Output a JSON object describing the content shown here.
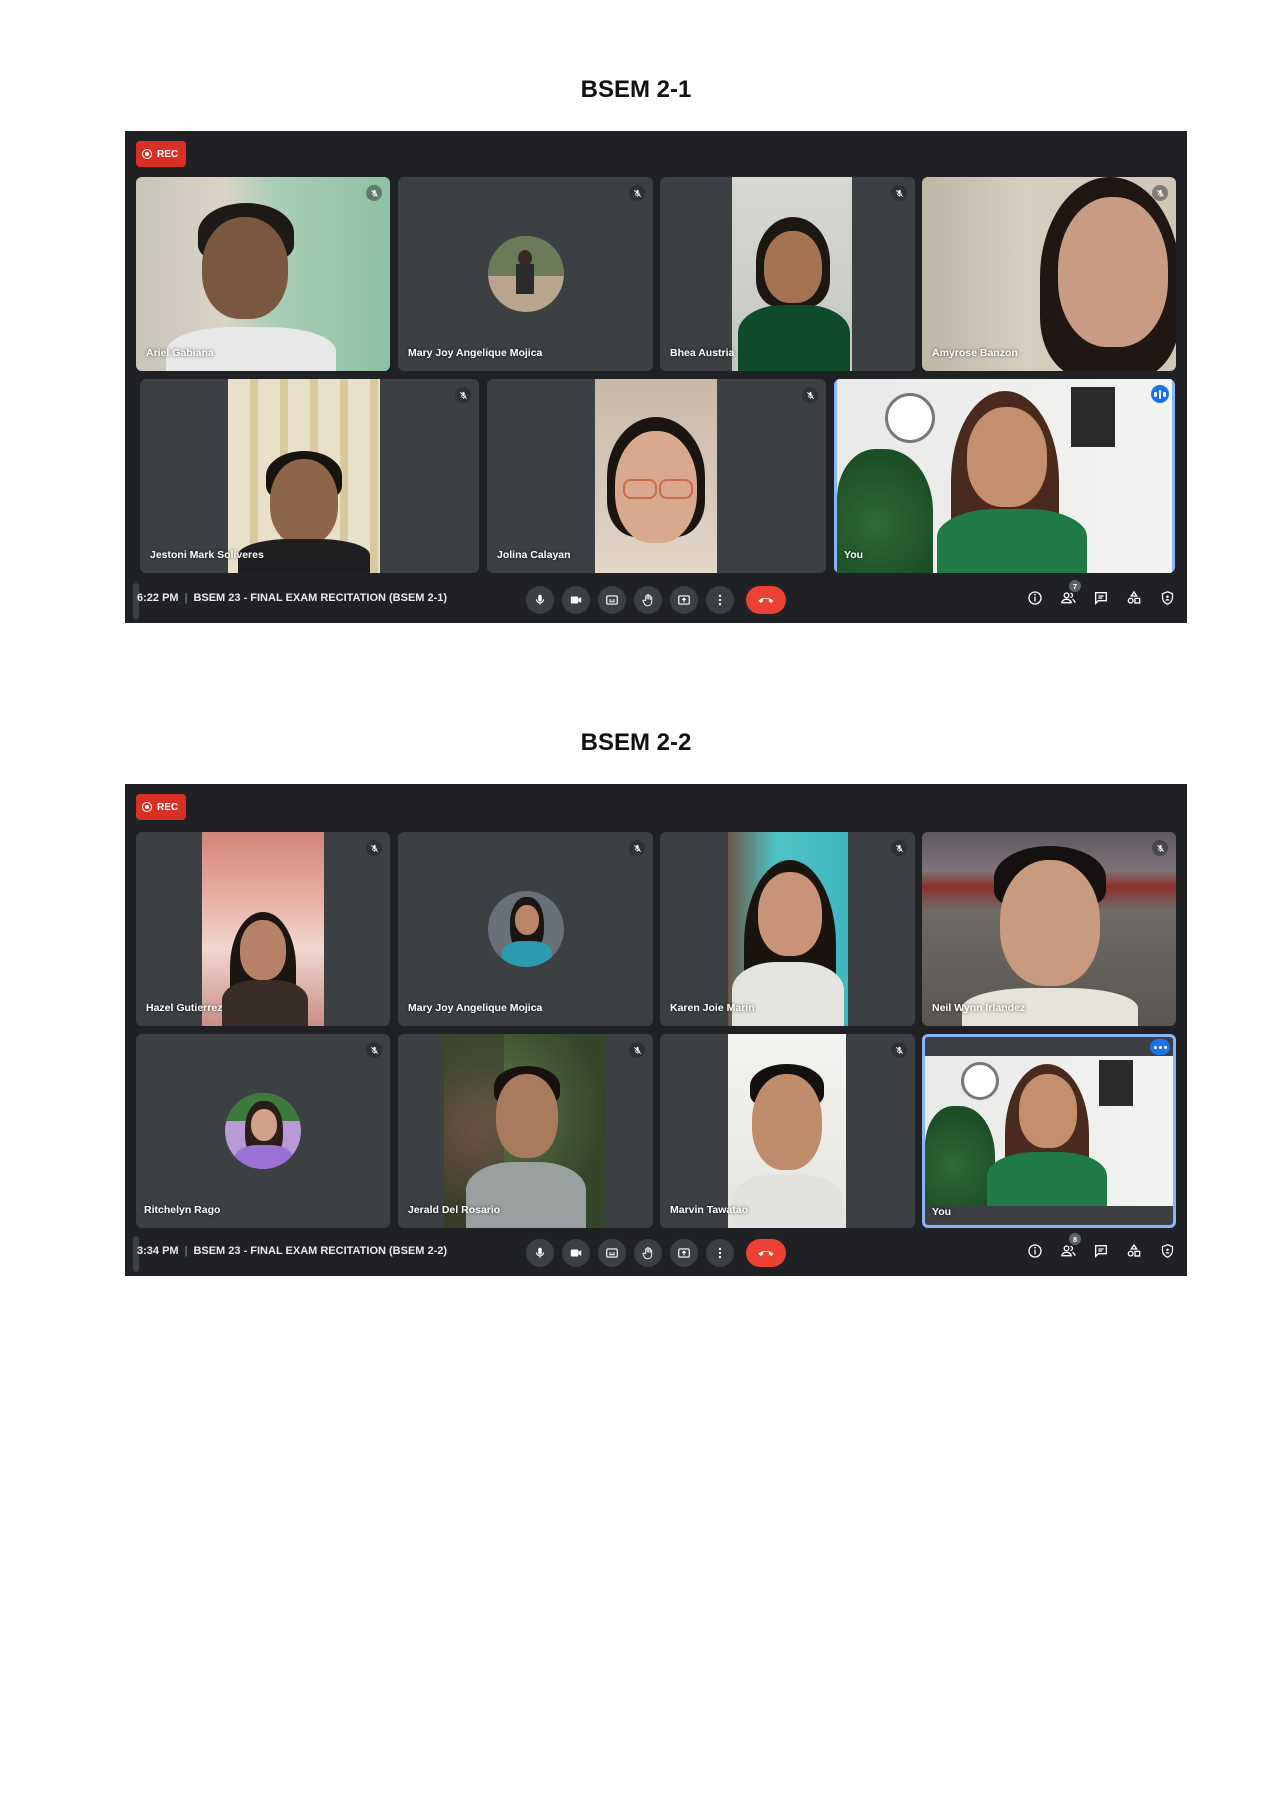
{
  "sections": [
    {
      "title": "BSEM 2-1",
      "rec_label": "REC",
      "participants": [
        {
          "name": "Ariel Gabiana"
        },
        {
          "name": "Mary Joy Angelique Mojica"
        },
        {
          "name": "Bhea Austria"
        },
        {
          "name": "Amyrose Banzon"
        },
        {
          "name": "Jestoni Mark Soliveres"
        },
        {
          "name": "Jolina Calayan"
        },
        {
          "name": "You"
        }
      ],
      "time": "6:22 PM",
      "meeting_title": "BSEM 23 - FINAL EXAM RECITATION (BSEM 2-1)",
      "people_count": "7"
    },
    {
      "title": "BSEM 2-2",
      "rec_label": "REC",
      "participants": [
        {
          "name": "Hazel Gutierrez"
        },
        {
          "name": "Mary Joy Angelique Mojica"
        },
        {
          "name": "Karen Joie Marin"
        },
        {
          "name": "Neil Wynn Irlandez"
        },
        {
          "name": "Ritchelyn Rago"
        },
        {
          "name": "Jerald Del Rosario"
        },
        {
          "name": "Marvin Tawatao"
        },
        {
          "name": "You"
        }
      ],
      "time": "3:34 PM",
      "meeting_title": "BSEM 23 - FINAL EXAM RECITATION (BSEM 2-2)",
      "people_count": "8"
    }
  ],
  "icons": {
    "mic": "mic-icon",
    "camera": "camera-icon",
    "captions": "captions-icon",
    "raise_hand": "hand-icon",
    "present": "present-icon",
    "more": "more-vert-icon",
    "end_call": "end-call-icon",
    "info": "info-icon",
    "people": "people-icon",
    "chat": "chat-icon",
    "activities": "activities-icon",
    "host_controls": "shield-icon",
    "muted": "mic-off-icon"
  },
  "colors": {
    "meet_background": "#202124",
    "tile_background": "#3c4043",
    "rec_red": "#d93025",
    "end_call_red": "#ea4335",
    "active_speaker_blue": "#1a73e8"
  }
}
